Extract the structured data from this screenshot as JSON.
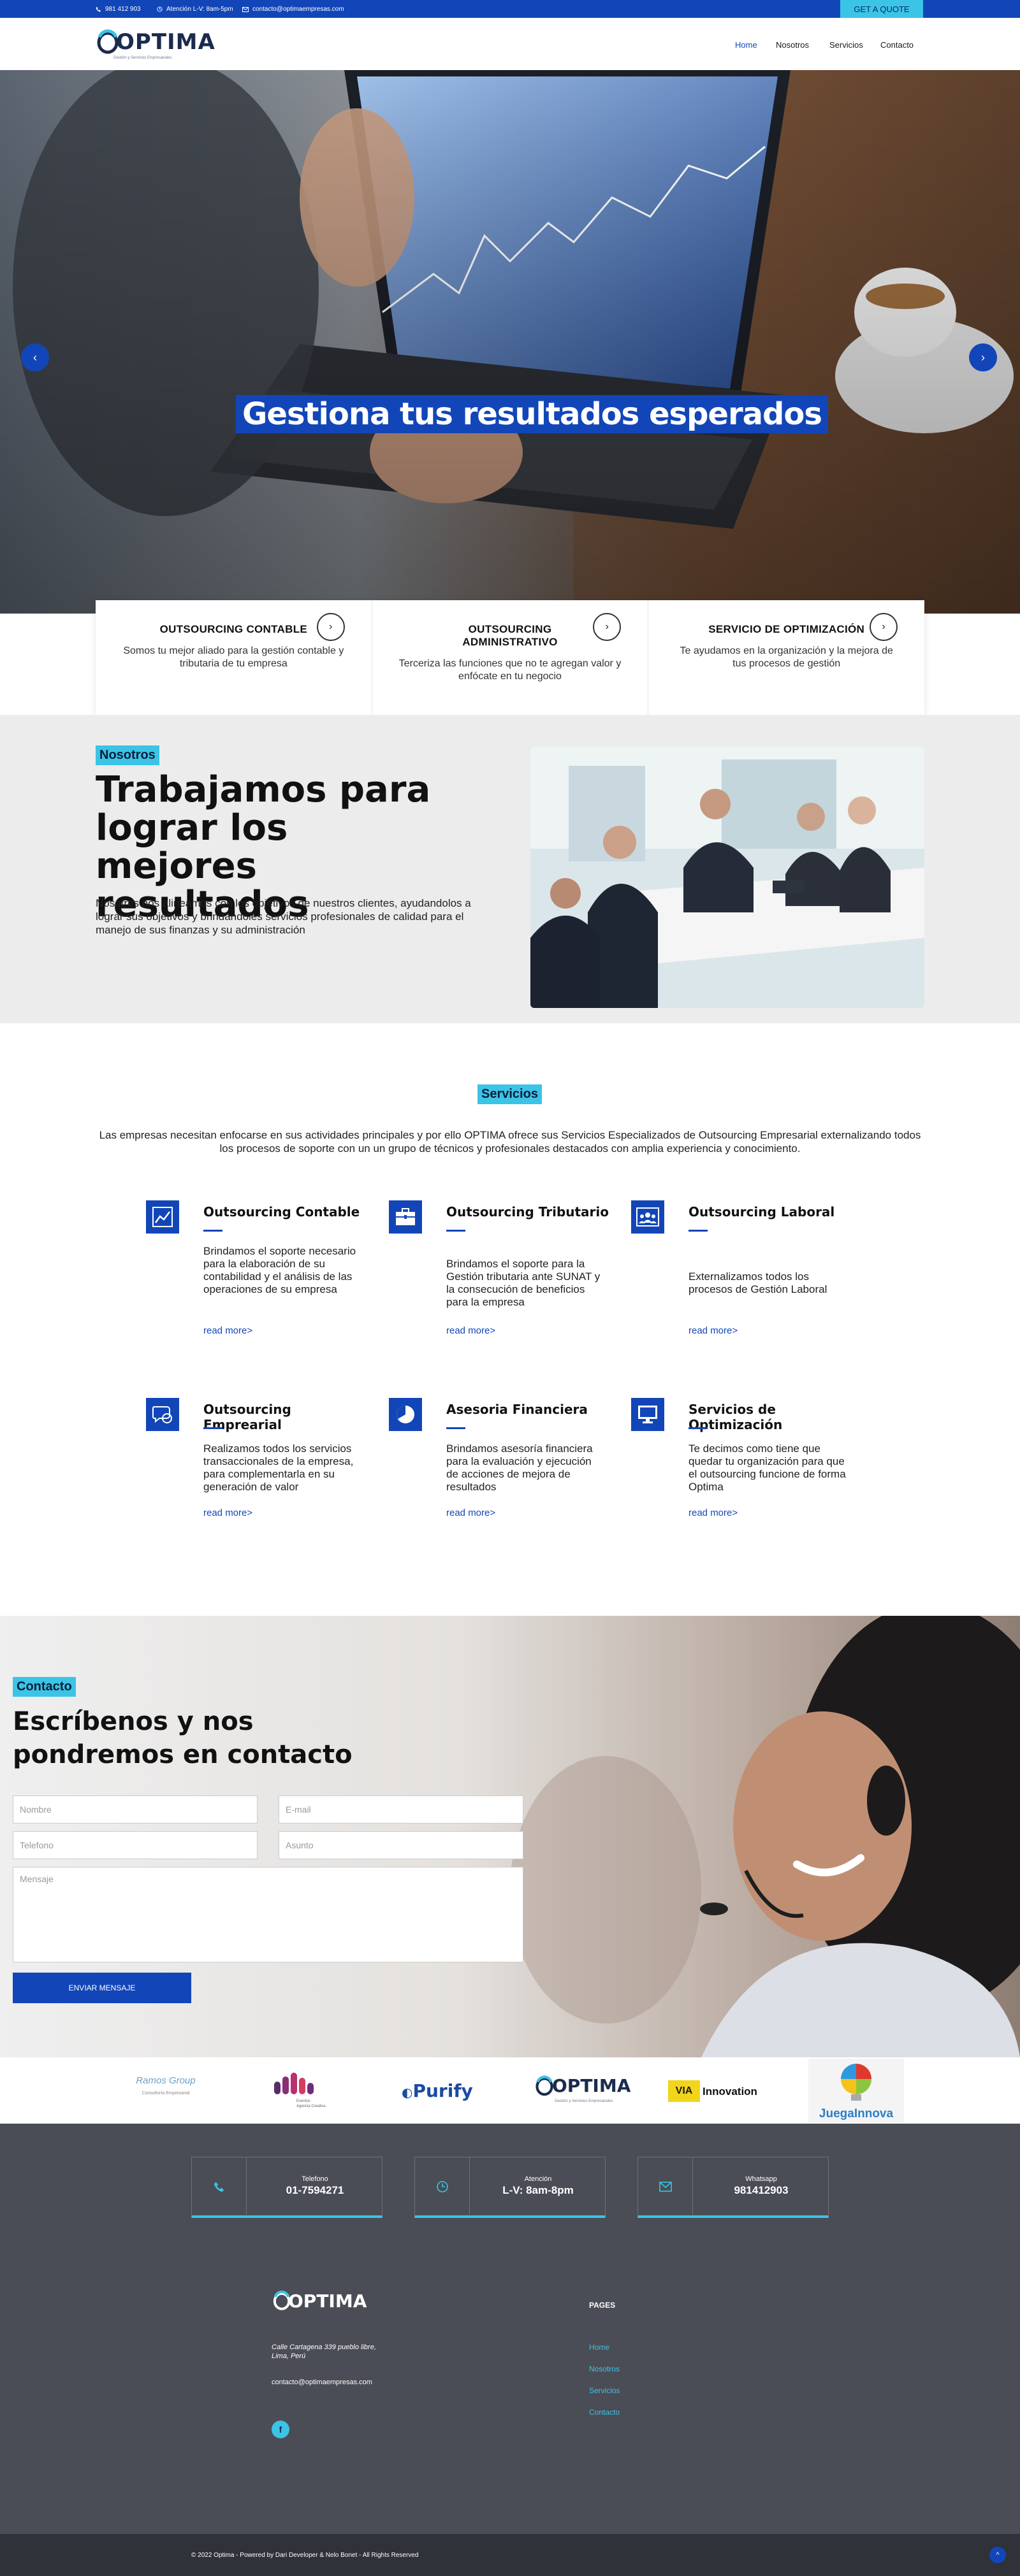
{
  "topbar": {
    "phone": "981 412 903",
    "hours": "Atención L-V: 8am-5pm",
    "email": "contacto@optimaempresas.com",
    "quote_label": "GET A QUOTE"
  },
  "brand": {
    "name": "OPTIMA",
    "tagline": "Gestión y Servicios Empresariales",
    "accent": "#1246b8",
    "accent_light": "#3bc4e6"
  },
  "nav": [
    "Home",
    "Nosotros",
    "Servicios",
    "Contacto"
  ],
  "hero": {
    "title": "Gestiona tus resultados esperados"
  },
  "features": [
    {
      "title": "OUTSOURCING CONTABLE",
      "text": "Somos tu mejor aliado para la gestión contable y tributaria de tu empresa"
    },
    {
      "title": "OUTSOURCING ADMINISTRATIVO",
      "text": "Terceriza las funciones que no te agregan valor y enfócate en tu negocio"
    },
    {
      "title": "SERVICIO DE OPTIMIZACIÓN",
      "text": "Te ayudamos en la organización y la mejora de tus procesos de gestión"
    }
  ],
  "about": {
    "tag": "Nosotros",
    "title": "Trabajamos para lograr los mejores resultados",
    "text": "Nosotros nos alineamos con los objetivos de nuestros clientes, ayudandolos a lograr sus objetivos y brindandoles servicios profesionales de calidad para el manejo de sus finanzas y su administración"
  },
  "services": {
    "tag": "Servicios",
    "intro": "Las empresas necesitan enfocarse en sus actividades principales y por ello OPTIMA ofrece sus Servicios Especializados de Outsourcing Empresarial externalizando todos los procesos de soporte con un un grupo de técnicos y profesionales destacados con amplia experiencia y conocimiento.",
    "read_more": "read more>",
    "items": [
      {
        "icon": "chart-icon",
        "title": "Outsourcing Contable",
        "text": "Brindamos el soporte necesario para la elaboración de su contabilidad y el análisis de las operaciones de su empresa"
      },
      {
        "icon": "briefcase-icon",
        "title": "Outsourcing Tributario",
        "text": "Brindamos el soporte para la Gestión tributaria ante SUNAT y la consecución de beneficios para la empresa"
      },
      {
        "icon": "people-icon",
        "title": "Outsourcing Laboral",
        "text": "Externalizamos todos los procesos de Gestión Laboral"
      },
      {
        "icon": "chat-icon",
        "title": "Outsourcing Emprearial",
        "text": "Realizamos todos los servicios transaccionales de la empresa, para complementarla en su generación de valor"
      },
      {
        "icon": "pie-icon",
        "title": "Asesoria Financiera",
        "text": "Brindamos asesoría financiera para la evaluación y ejecución de acciones de mejora de resultados"
      },
      {
        "icon": "monitor-icon",
        "title": "Servicios de Optimización",
        "text": "Te decimos como tiene que quedar tu organización para que el outsourcing funcione de forma Optima"
      }
    ]
  },
  "contact": {
    "tag": "Contacto",
    "title": "Escríbenos y nos pondremos en contacto",
    "placeholders": {
      "name": "Nombre",
      "email": "E-mail",
      "phone": "Telefono",
      "subject": "Asunto",
      "message": "Mensaje"
    },
    "send_label": "ENVIAR MENSAJE"
  },
  "partners": [
    {
      "name": "Ramos Group",
      "sub": "Consultoría Empresarial"
    },
    {
      "name": "Eventos",
      "sub": "Agencia Creativa"
    },
    {
      "name": "Purify",
      "sub": ""
    },
    {
      "name": "OPTIMA",
      "sub": "Gestión y Servicios Empresariales"
    },
    {
      "name": "VIA Innovation",
      "sub": ""
    },
    {
      "name": "JuegaInnova",
      "sub": ""
    }
  ],
  "footer": {
    "boxes": [
      {
        "icon": "phone-icon",
        "label": "Telefono",
        "value": "01-7594271"
      },
      {
        "icon": "clock-icon",
        "label": "Atención",
        "value": "L-V: 8am-8pm"
      },
      {
        "icon": "mail-icon",
        "label": "Whatsapp",
        "value": "981412903"
      }
    ],
    "address_line1": "Calle Cartagena 339 pueblo libre,",
    "address_line2": "Lima, Perú",
    "email": "contacto@optimaempresas.com",
    "pages_title": "PAGES",
    "pages": [
      "Home",
      "Nosotros",
      "Servicios",
      "Contacto"
    ],
    "copyright": "© 2022 Optima - Powered by Dari Developer & Nelo Bonet - All Rights Reserved"
  }
}
